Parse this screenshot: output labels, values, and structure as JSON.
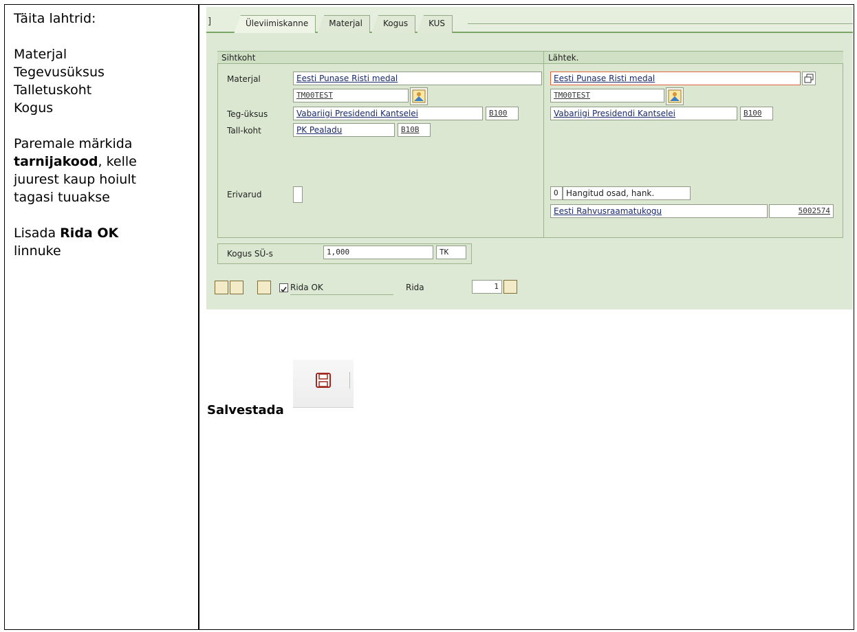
{
  "instructions": {
    "heading": "Täita lahtrid:",
    "fields": [
      "Materjal",
      "Tegevusüksus",
      "Talletuskoht",
      "Kogus"
    ],
    "supplier_before": "Paremale märkida",
    "supplier_bold": "tarnijakood",
    "supplier_after": ", kelle",
    "supplier_line2": "juurest kaup hoiult",
    "supplier_line3": "tagasi tuuakse",
    "check_before": "Lisada",
    "check_bold": "Rida OK",
    "check_line2": "linnuke"
  },
  "tabs": [
    "Üleviimiskanne",
    "Materjal",
    "Kogus",
    "KUS"
  ],
  "target": {
    "heading": "Sihtkoht",
    "material_label": "Materjal",
    "material_value": "Eesti Punase Risti medal",
    "material_code": "TM00TEST",
    "unit_label": "Teg-üksus",
    "unit_value": "Vabariigi Presidendi Kantselei",
    "unit_code": "B100",
    "storage_label": "Tall-koht",
    "storage_value": "PK Pealadu",
    "storage_code": "B10B",
    "special_label": "Erivarud"
  },
  "source": {
    "heading": "Lähtek.",
    "material_value": "Eesti Punase Risti medal",
    "material_code": "TM00TEST",
    "unit_value": "Vabariigi Presidendi Kantselei",
    "unit_code": "B100",
    "stock_code": "O",
    "stock_text": "Hangitud osad, hank.",
    "supplier_name": "Eesti Rahvusraamatukogu",
    "supplier_code": "5002574"
  },
  "quantity": {
    "label": "Kogus SÜ-s",
    "value": "1,000",
    "unit": "TK"
  },
  "footer": {
    "rida_ok_label": "Rida OK",
    "rida_ok_checked": true,
    "rida_label": "Rida",
    "rida_value": "1"
  },
  "save": {
    "label": "Salvestada",
    "icon": "save-icon"
  },
  "colors": {
    "sap_background": "#dde9d5",
    "link_text": "#1a2a6a",
    "save_icon": "#c0392b"
  }
}
